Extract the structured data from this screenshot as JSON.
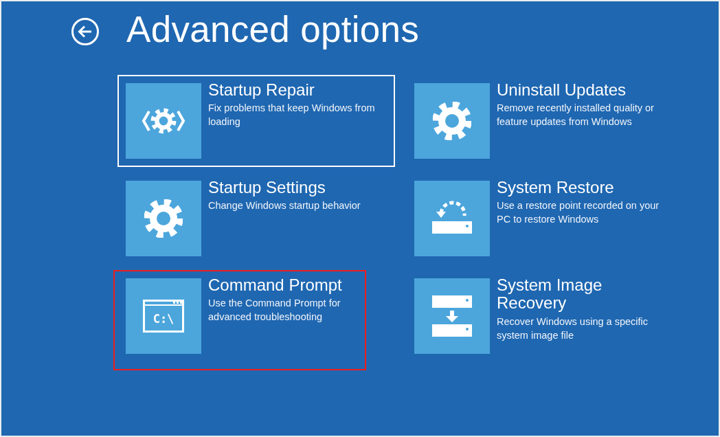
{
  "title": "Advanced options",
  "options": [
    {
      "kind": "repair",
      "title": "Startup Repair",
      "description": "Fix problems that keep Windows from loading",
      "focused": true,
      "highlighted": false
    },
    {
      "kind": "gear",
      "title": "Uninstall Updates",
      "description": "Remove recently installed quality or feature updates from Windows",
      "focused": false,
      "highlighted": false
    },
    {
      "kind": "gear",
      "title": "Startup Settings",
      "description": "Change Windows startup behavior",
      "focused": false,
      "highlighted": false
    },
    {
      "kind": "restore",
      "title": "System Restore",
      "description": "Use a restore point recorded on your PC to restore Windows",
      "focused": false,
      "highlighted": false
    },
    {
      "kind": "console",
      "icon_text": "C:\\",
      "title": "Command Prompt",
      "description": "Use the Command Prompt for advanced troubleshooting",
      "focused": false,
      "highlighted": true
    },
    {
      "kind": "image",
      "title": "System Image Recovery",
      "description": "Recover Windows using a specific system image file",
      "focused": false,
      "highlighted": false
    }
  ]
}
